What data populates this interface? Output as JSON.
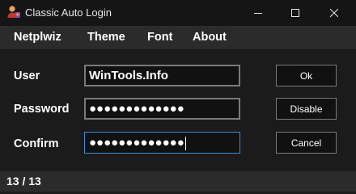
{
  "window": {
    "title": "Classic Auto Login",
    "icon": "user-key-icon"
  },
  "menu": {
    "items": [
      {
        "label": "Netplwiz"
      },
      {
        "label": "Theme"
      },
      {
        "label": "Font"
      },
      {
        "label": "About"
      }
    ]
  },
  "form": {
    "user_label": "User",
    "user_value": "WinTools.Info",
    "password_label": "Password",
    "password_value": "●●●●●●●●●●●●●",
    "confirm_label": "Confirm",
    "confirm_value": "●●●●●●●●●●●●●"
  },
  "buttons": {
    "ok": "Ok",
    "disable": "Disable",
    "cancel": "Cancel"
  },
  "status": {
    "text": "13 / 13"
  },
  "colors": {
    "background": "#1b1b1b",
    "titlebar": "#151515",
    "menubar": "#2b2b2b",
    "field_border": "#7a7a7a",
    "focus_border": "#3c8ad8"
  }
}
